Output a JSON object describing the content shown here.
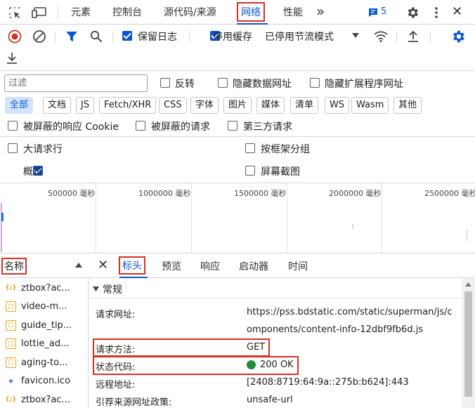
{
  "topbar": {
    "tabs": [
      "元素",
      "控制台",
      "源代码/来源",
      "网络",
      "性能"
    ],
    "active_tab": "网络",
    "more": "»",
    "issues_count": "5",
    "close": "✕"
  },
  "toolbar": {
    "preserve_log": "保留日志",
    "disable_cache": "停用缓存",
    "throttle": "已停用节流模式"
  },
  "filter": {
    "placeholder": "过滤",
    "invert": "反转",
    "hide_data_urls": "隐藏数据网址",
    "hide_ext_urls": "隐藏扩展程序网址"
  },
  "types": [
    "全部",
    "文档",
    "JS",
    "Fetch/XHR",
    "CSS",
    "字体",
    "图片",
    "媒体",
    "清单",
    "WS",
    "Wasm",
    "其他"
  ],
  "options": {
    "blocked_cookies": "被屏蔽的响应 Cookie",
    "blocked_requests": "被屏蔽的请求",
    "third_party": "第三方请求",
    "big_rows": "大请求行",
    "group_by_frame": "按框架分组",
    "overview": "概览",
    "screenshots": "屏幕截图"
  },
  "timeline": {
    "ticks": [
      "500000 毫秒",
      "1000000 毫秒",
      "1500000 毫秒",
      "2000000 毫秒",
      "2500000 毫秒"
    ]
  },
  "requests": {
    "header": "名称",
    "items": [
      {
        "name": "ztbox?ac...",
        "type": "xhr"
      },
      {
        "name": "video-m...",
        "type": "script"
      },
      {
        "name": "guide_tip...",
        "type": "script"
      },
      {
        "name": "lottie_ad...",
        "type": "script"
      },
      {
        "name": "aging-to...",
        "type": "script"
      },
      {
        "name": "favicon.ico",
        "type": "image"
      },
      {
        "name": "ztbox?ac...",
        "type": "xhr"
      }
    ]
  },
  "detail": {
    "tabs": [
      "标头",
      "预览",
      "响应",
      "启动器",
      "时间"
    ],
    "active_tab": "标头",
    "section": "常规",
    "rows": [
      {
        "key": "请求网址:",
        "value": "https://pss.bdstatic.com/static/superman/js/c"
      },
      {
        "key": "",
        "value": "omponents/content-info-12dbf9fb6d.js"
      },
      {
        "key": "请求方法:",
        "value": "GET"
      },
      {
        "key": "状态代码:",
        "value": "200 OK"
      },
      {
        "key": "远程地址:",
        "value": "[2408:8719:64:9a::275b:b624]:443"
      },
      {
        "key": "引荐来源网址政策:",
        "value": "unsafe-url"
      }
    ]
  },
  "colors": {
    "accent": "#0b57d0",
    "highlight": "#d93025",
    "record": "#d93025",
    "status_ok": "#1e8e3e"
  }
}
